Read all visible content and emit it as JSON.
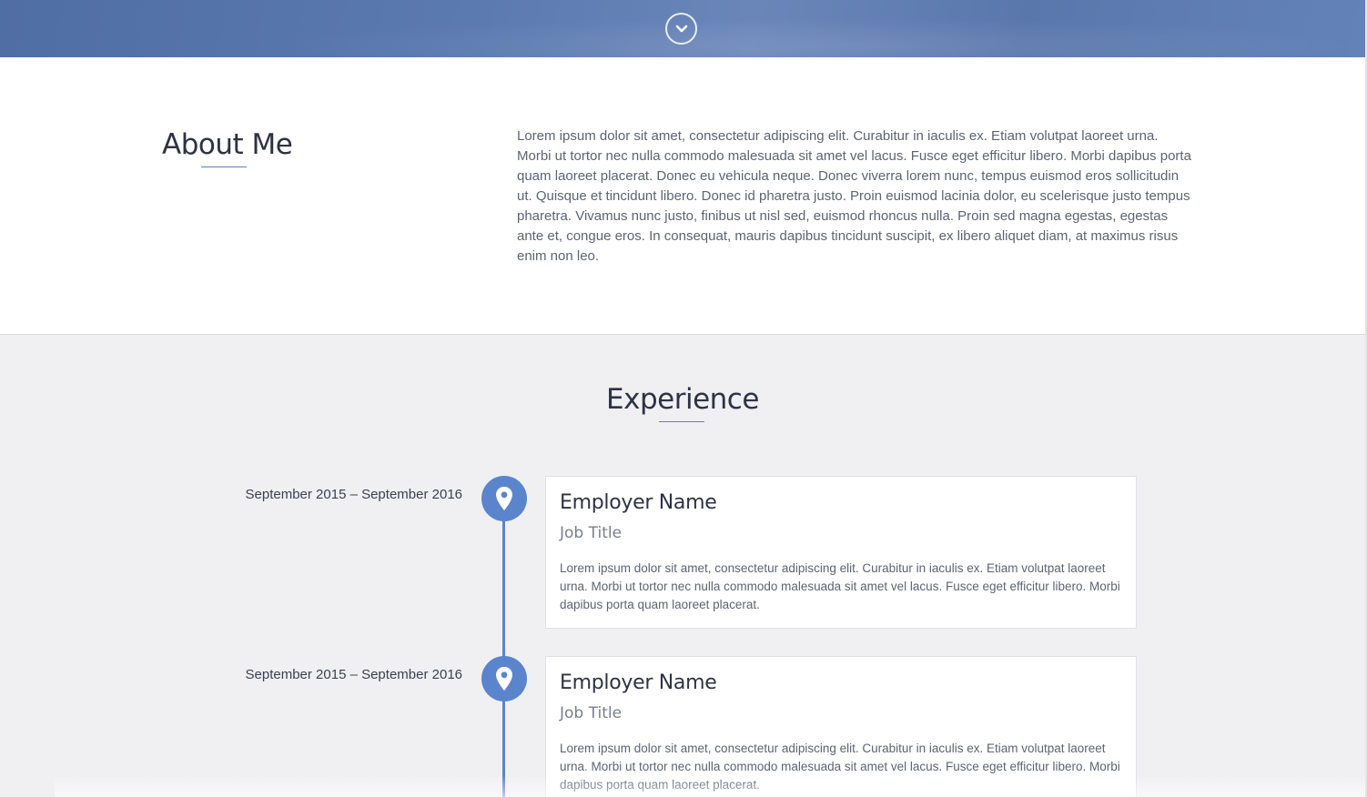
{
  "hero": {
    "scroll_icon": "chevron-down-circle-icon",
    "accent": "#5a77ac"
  },
  "about": {
    "title": "About Me",
    "text": "Lorem ipsum dolor sit amet, consectetur adipiscing elit. Curabitur in iaculis ex. Etiam volutpat laoreet urna. Morbi ut tortor nec nulla commodo malesuada sit amet vel lacus. Fusce eget efficitur libero. Morbi dapibus porta quam laoreet placerat. Donec eu vehicula neque. Donec viverra lorem nunc, tempus euismod eros sollicitudin ut. Quisque et tincidunt libero. Donec id pharetra justo. Proin euismod lacinia dolor, eu scelerisque justo tempus pharetra. Vivamus nunc justo, finibus ut nisl sed, euismod rhoncus nulla. Proin sed magna egestas, egestas ante et, congue eros. In consequat, mauris dapibus tincidunt suscipit, ex libero aliquet diam, at maximus risus enim non leo."
  },
  "experience": {
    "title": "Experience",
    "marker_icon": "map-pin-icon",
    "accent": "#5a85cc",
    "entries": [
      {
        "date": "September 2015 – September 2016",
        "employer": "Employer Name",
        "job_title": "Job Title",
        "description": "Lorem ipsum dolor sit amet, consectetur adipiscing elit. Curabitur in iaculis ex. Etiam volutpat laoreet urna. Morbi ut tortor nec nulla commodo malesuada sit amet vel lacus. Fusce eget efficitur libero. Morbi dapibus porta quam laoreet placerat."
      },
      {
        "date": "September 2015 – September 2016",
        "employer": "Employer Name",
        "job_title": "Job Title",
        "description": "Lorem ipsum dolor sit amet, consectetur adipiscing elit. Curabitur in iaculis ex. Etiam volutpat laoreet urna. Morbi ut tortor nec nulla commodo malesuada sit amet vel lacus. Fusce eget efficitur libero. Morbi dapibus porta quam laoreet placerat."
      }
    ]
  }
}
